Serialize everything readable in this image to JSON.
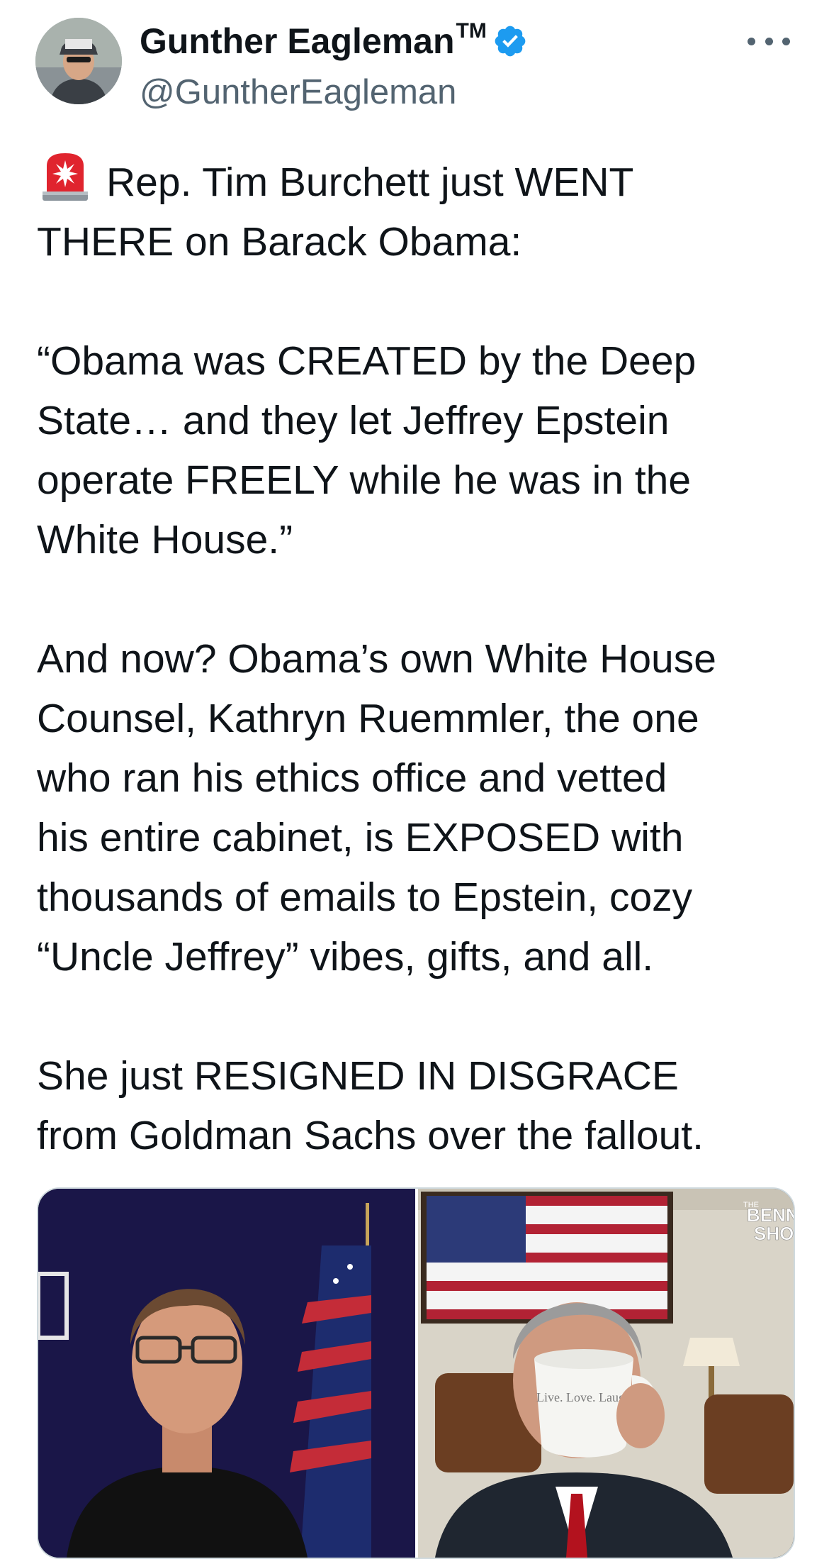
{
  "tweet": {
    "author": {
      "name": "Gunther Eagleman",
      "trademark": "TM",
      "handle": "@GuntherEagleman",
      "verified": true,
      "verified_icon": "verified-badge-icon"
    },
    "more_icon": "more-options-icon",
    "body": {
      "p1_line1": "Rep. Tim Burchett just WENT",
      "p1_line2": "THERE on Barack Obama:",
      "p2_line1": "“Obama was CREATED by the Deep",
      "p2_line2": "State… and they let Jeffrey Epstein",
      "p2_line3": "operate FREELY while he was in the",
      "p2_line4": "White House.”",
      "p3_line1": "And now? Obama’s own White House",
      "p3_line2": "Counsel, Kathryn Ruemmler, the one",
      "p3_line3": "who ran his ethics office and vetted",
      "p3_line4": "his entire cabinet, is EXPOSED with",
      "p3_line5": "thousands of emails to Epstein, cozy",
      "p3_line6": "“Uncle Jeffrey” vibes, gifts, and all.",
      "p4_line1": "She just RESIGNED IN DISGRACE",
      "p4_line2": "from Goldman Sachs over the fallout."
    },
    "media": {
      "show_logo_line1": "BENNY",
      "show_logo_line2": "SHOW",
      "show_logo_prefix": "THE",
      "mug_text": "Live. Love. Laugh"
    }
  },
  "colors": {
    "text": "#0f1419",
    "secondary": "#536471",
    "verified": "#1d9bf0",
    "border": "#cfd9de"
  }
}
